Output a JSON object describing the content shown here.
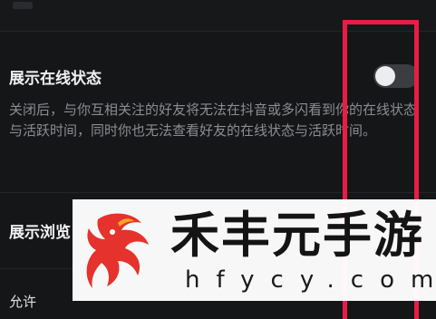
{
  "settings": {
    "online_status": {
      "title": "展示在线状态",
      "enabled": false,
      "description": "关闭后，与你互相关注的好友将无法在抖音或多闪看到你的在线状态与活跃时间，同时你也无法查看好友的在线状态与活跃时间。"
    },
    "browse_row": {
      "title": "展示浏览"
    },
    "partial_row_text": "允许"
  },
  "watermark": {
    "title": "禾丰元手游",
    "domain": "hfycy.com"
  },
  "colors": {
    "background": "#151618",
    "highlight_box": "#ea1c45",
    "toggle_track": "#3c3d41",
    "toggle_knob": "#ededf0",
    "logo_red": "#e5322d"
  },
  "icons": {
    "chevron": "chevron-right-icon",
    "logo": "dragon-logo-icon"
  }
}
